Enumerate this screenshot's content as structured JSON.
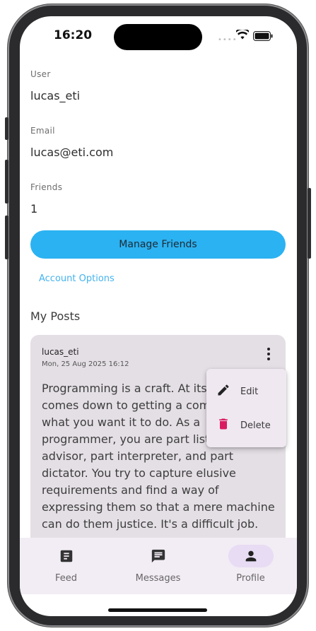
{
  "status_bar": {
    "time": "16:20"
  },
  "profile": {
    "user_label": "User",
    "user_value": "lucas_eti",
    "email_label": "Email",
    "email_value": "lucas@eti.com",
    "friends_label": "Friends",
    "friends_value": "1",
    "manage_friends_label": "Manage Friends",
    "account_options_label": "Account Options"
  },
  "posts_section": {
    "title": "My Posts",
    "post": {
      "author": "lucas_eti",
      "date": "Mon, 25 Aug 2025 16:12",
      "body": "Programming is a craft. At its simplest, it comes down to getting a computer to do what you want it to do. As a programmer, you are part listener part advisor, part interpreter, and part dictator. You try to capture elusive requirements and find a way of expressing them so that a mere machine can do them justice. It's a difficult job."
    }
  },
  "context_menu": {
    "items": [
      {
        "label": "Edit",
        "icon": "pencil-icon"
      },
      {
        "label": "Delete",
        "icon": "trash-icon"
      }
    ]
  },
  "bottom_nav": {
    "items": [
      {
        "label": "Feed",
        "icon": "feed-icon",
        "active": false
      },
      {
        "label": "Messages",
        "icon": "message-icon",
        "active": false
      },
      {
        "label": "Profile",
        "icon": "person-icon",
        "active": true
      }
    ]
  },
  "colors": {
    "primary_button": "#2bb2f2",
    "link": "#44b3ee",
    "card_background": "#e4dfe5",
    "nav_background": "#f2ecf4",
    "nav_active_pill": "#e7dcf3",
    "delete_icon": "#d81b60"
  }
}
